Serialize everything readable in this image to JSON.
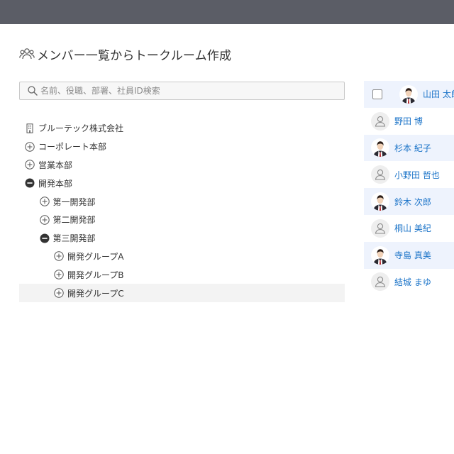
{
  "page": {
    "title": "メンバー一覧からトークルーム作成",
    "search_placeholder": "名前、役職、部署、社員ID検索"
  },
  "tree": [
    {
      "label": "ブルーテック株式会社",
      "icon": "building-icon",
      "level": 0
    },
    {
      "label": "コーポレート本部",
      "icon": "expand-plus-icon",
      "level": 0
    },
    {
      "label": "営業本部",
      "icon": "expand-plus-icon",
      "level": 0
    },
    {
      "label": "開発本部",
      "icon": "collapse-minus-icon",
      "level": 0
    },
    {
      "label": "第一開発部",
      "icon": "expand-plus-icon",
      "level": 1
    },
    {
      "label": "第二開発部",
      "icon": "expand-plus-icon",
      "level": 1
    },
    {
      "label": "第三開発部",
      "icon": "collapse-minus-icon",
      "level": 1
    },
    {
      "label": "開発グループA",
      "icon": "expand-plus-icon",
      "level": 2
    },
    {
      "label": "開発グループB",
      "icon": "expand-plus-icon",
      "level": 2
    },
    {
      "label": "開発グループC",
      "icon": "expand-plus-icon",
      "level": 2,
      "selected": true
    }
  ],
  "members": [
    {
      "name": "山田 太郎",
      "avatar": "photo",
      "checkbox": true
    },
    {
      "name": "野田 博",
      "avatar": "default"
    },
    {
      "name": "杉本 紀子",
      "avatar": "photo"
    },
    {
      "name": "小野田 哲也",
      "avatar": "default"
    },
    {
      "name": "鈴木 次郎",
      "avatar": "photo"
    },
    {
      "name": "桐山 美紀",
      "avatar": "default"
    },
    {
      "name": "寺島 真美",
      "avatar": "photo"
    },
    {
      "name": "結城 まゆ",
      "avatar": "default"
    }
  ],
  "colors": {
    "topbar": "#5b5d66",
    "link": "#1a73c8",
    "row_highlight": "#eef3fd",
    "selected_row": "#f3f3f3"
  }
}
